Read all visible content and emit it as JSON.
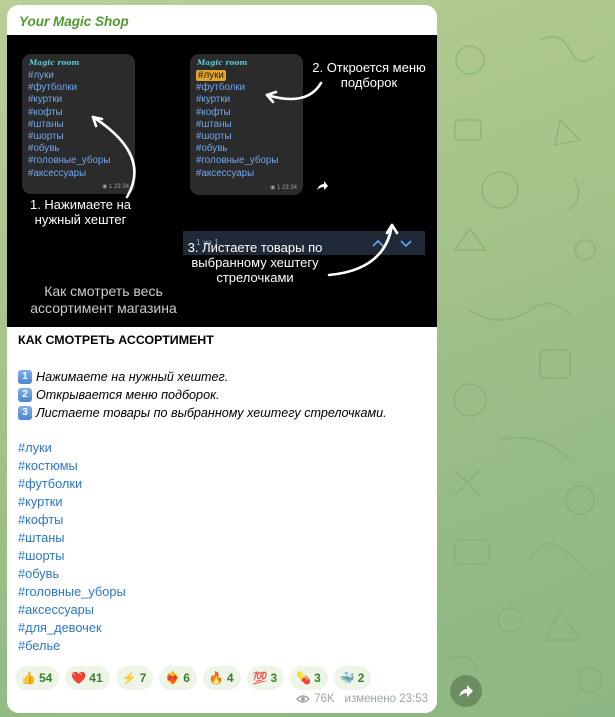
{
  "colors": {
    "accent": "#4e9a2c",
    "link": "#2b76c7",
    "reaction_bg": "#edf5e8"
  },
  "channel": {
    "name": "Your Magic Shop"
  },
  "promo": {
    "left_bubble": {
      "title": "Magic room",
      "tags": [
        "#луки",
        "#футболки",
        "#куртки",
        "#кофты",
        "#штаны",
        "#шорты",
        "#обувь",
        "#головные_уборы",
        "#аксессуары"
      ],
      "time": "1 23:34"
    },
    "right_bubble": {
      "title": "Magic room",
      "highlight": "#луки",
      "tags": [
        "#футболки",
        "#куртки",
        "#кофты",
        "#штаны",
        "#шорты",
        "#обувь",
        "#головные_уборы",
        "#аксессуары"
      ],
      "time": "1 23:34"
    },
    "nav": {
      "counter": "1 из 1",
      "up_icon": "chevron-up-icon",
      "down_icon": "chevron-down-icon"
    },
    "captions": {
      "c1": "1. Нажимаете на нужный хештег",
      "c2": "2. Откроется меню подборок",
      "c3": "3. Листаете товары по выбранному хештегу стрелочками",
      "c4": "Как смотреть весь ассортимент магазина"
    }
  },
  "post": {
    "title": "КАК СМОТРЕТЬ АССОРТИМЕНТ",
    "steps": [
      {
        "num": "1",
        "text": "Нажимаете на нужный хештег."
      },
      {
        "num": "2",
        "text": "Открывается меню подборок."
      },
      {
        "num": "3",
        "text": "Листаете товары по выбранному хештегу стрелочками."
      }
    ],
    "hashtags": [
      "#луки",
      "#костюмы",
      "#футболки",
      "#куртки",
      "#кофты",
      "#штаны",
      "#шорты",
      "#обувь",
      "#головные_уборы",
      "#аксессуары",
      "#для_девочек",
      "#белье"
    ]
  },
  "reactions": [
    {
      "emoji": "👍",
      "count": "54"
    },
    {
      "emoji": "❤️",
      "count": "41"
    },
    {
      "emoji": "⚡",
      "count": "7"
    },
    {
      "emoji": "❤‍🔥",
      "count": "6"
    },
    {
      "emoji": "🔥",
      "count": "4"
    },
    {
      "emoji": "💯",
      "count": "3"
    },
    {
      "emoji": "💊",
      "count": "3"
    },
    {
      "emoji": "🐳",
      "count": "2"
    }
  ],
  "meta": {
    "views": "76K",
    "edited": "изменено 23:53",
    "eye_icon": "eye-icon"
  },
  "share": {
    "icon": "share-arrow-icon"
  }
}
